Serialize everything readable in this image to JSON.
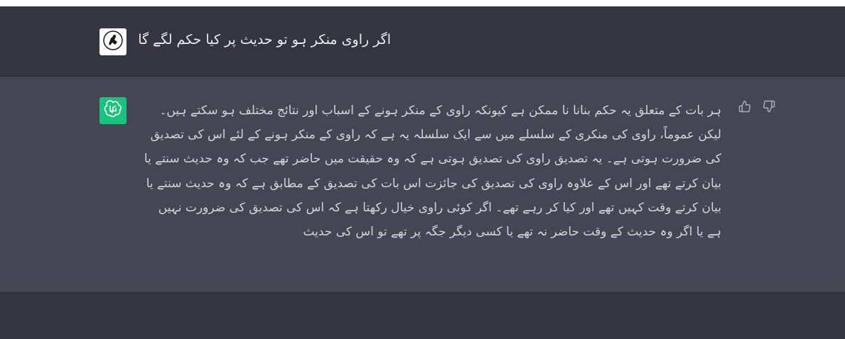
{
  "conversation": {
    "user_message": "اگر راوی منکر ہو تو حدیث پر کیا حکم لگے گا",
    "assistant_message": "ہر بات کے متعلق یہ حکم بنانا نا ممکن ہے کیونکہ راوی کے منکر ہونے کے اسباب اور نتائج مختلف ہو سکتے ہیں۔ لیکن عموماً، راوی کی منکری کے سلسلے میں سے ایک سلسلہ یہ ہے کہ راوی کے منکر ہونے کے لئے اس کی تصدیق کی ضرورت ہوتی ہے۔ یہ تصدیق راوی کی تصدیق ہوتی ہے کہ وہ حقیقت میں حاضر تھے جب کہ وہ حدیث سنتے یا بیان کرتے تھے اور اس کے علاوہ راوی کی تصدیق کی جائزت اس بات کی تصدیق کے مطابق ہے کہ وہ حدیث سنتے یا بیان کرتے وقت کہیں تھے اور کیا کر رہے تھے۔ اگر کوئی راوی خیال رکھتا ہے کہ اس کی تصدیق کی ضرورت نہیں ہے یا اگر وہ حدیث کے وقت حاضر نہ تھے یا کسی دیگر جگہ پر تھے تو اس کی حدیث"
  },
  "avatars": {
    "user_icon": "user-avatar-icon",
    "assistant_icon": "openai-logo-icon",
    "assistant_bg": "#19c37d"
  },
  "feedback": {
    "thumbs_up_icon": "thumbs-up-icon",
    "thumbs_down_icon": "thumbs-down-icon"
  },
  "colors": {
    "page_bg": "#343541",
    "assistant_row_bg": "#444654",
    "text_user": "#ececf1",
    "text_assistant": "#d1d5db"
  }
}
